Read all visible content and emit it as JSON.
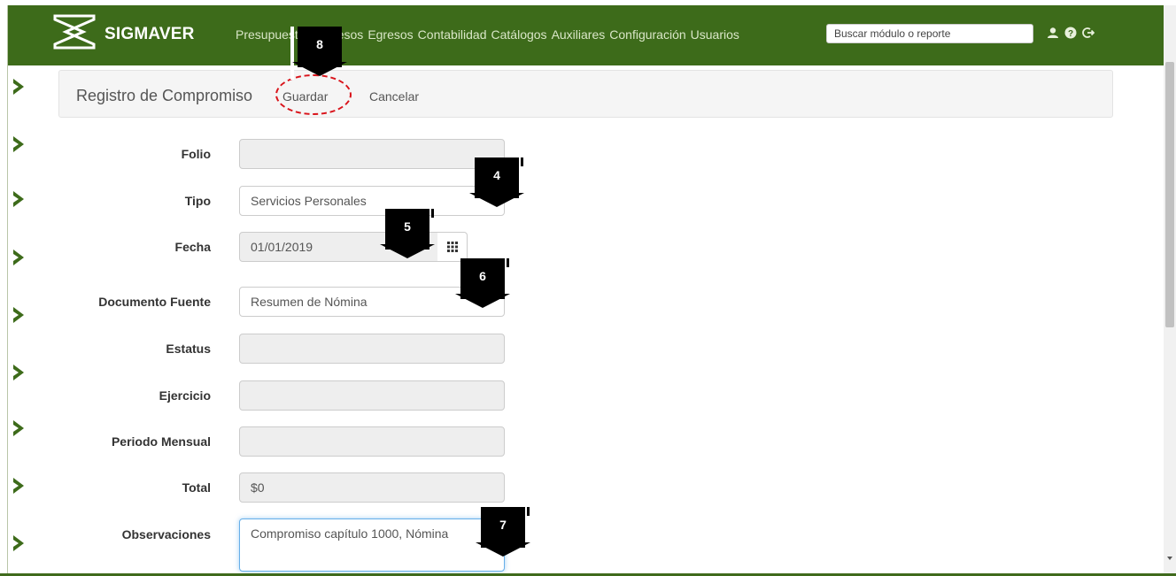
{
  "app": {
    "brand": "SIGMAVER"
  },
  "nav": {
    "items": [
      "Presupuestos",
      "Ingresos",
      "Egresos",
      "Contabilidad",
      "Catálogos",
      "Auxiliares",
      "Configuración",
      "Usuarios"
    ],
    "search_placeholder": "Buscar módulo o reporte",
    "icons": [
      "user-icon",
      "help-icon",
      "logout-icon"
    ]
  },
  "header": {
    "title": "Registro de Compromiso",
    "save_label": "Guardar",
    "cancel_label": "Cancelar"
  },
  "form": {
    "folio": {
      "label": "Folio",
      "value": ""
    },
    "tipo": {
      "label": "Tipo",
      "value": "Servicios Personales"
    },
    "fecha": {
      "label": "Fecha",
      "value": "01/01/2019"
    },
    "documento_fuente": {
      "label": "Documento Fuente",
      "value": "Resumen de Nómina"
    },
    "estatus": {
      "label": "Estatus",
      "value": ""
    },
    "ejercicio": {
      "label": "Ejercicio",
      "value": ""
    },
    "periodo_mensual": {
      "label": "Periodo Mensual",
      "value": ""
    },
    "total": {
      "label": "Total",
      "value": "$0"
    },
    "observaciones": {
      "label": "Observaciones",
      "value": "Compromiso capítulo 1000, Nómina"
    }
  },
  "markers": {
    "m4": "4",
    "m5": "5",
    "m6": "6",
    "m7": "7",
    "m8": "8"
  },
  "colors": {
    "navbar": "#3d6b1a",
    "chevron": "#3d6b1a",
    "highlight_ring": "#d9131a"
  }
}
